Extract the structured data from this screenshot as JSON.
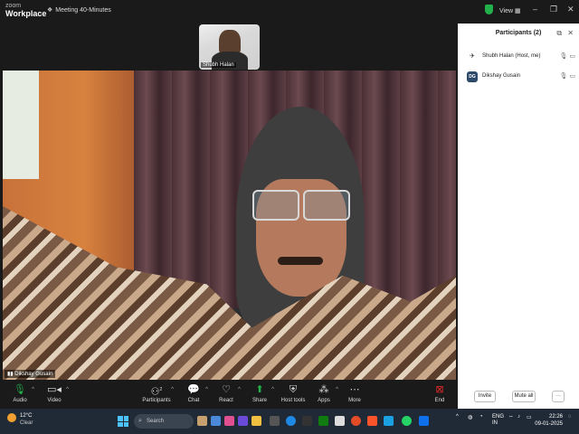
{
  "app": {
    "brand_top": "zoom",
    "brand_bottom": "Workplace",
    "meeting_title": "Meeting 40-Minutes",
    "view_label": "View"
  },
  "thumbnail": {
    "name": "Shubh Halan"
  },
  "main_video": {
    "name": "Dikshay Gusain"
  },
  "toolbar": {
    "audio": "Audio",
    "video": "Video",
    "participants": "Participants",
    "participants_count": "2",
    "chat": "Chat",
    "react": "React",
    "share": "Share",
    "host_tools": "Host tools",
    "apps": "Apps",
    "more": "More",
    "end": "End"
  },
  "participants_panel": {
    "title": "Participants (2)",
    "participants": [
      {
        "name": "Shubh Halan (Host, me)",
        "initials": "",
        "color": "#ffffff"
      },
      {
        "name": "Dikshay Gusain",
        "initials": "DG",
        "color": "#2d4a6a"
      }
    ],
    "invite": "Invite",
    "mute_all": "Mute all",
    "more": "···"
  },
  "taskbar": {
    "weather_temp": "12°C",
    "weather_desc": "Clear",
    "search": "Search",
    "lang_top": "ENG",
    "lang_bottom": "IN",
    "time": "22:26",
    "date": "09-01-2025"
  },
  "colors": {
    "accent": "#0e71eb",
    "end_red": "#e02828",
    "share_green": "#22b04a"
  }
}
